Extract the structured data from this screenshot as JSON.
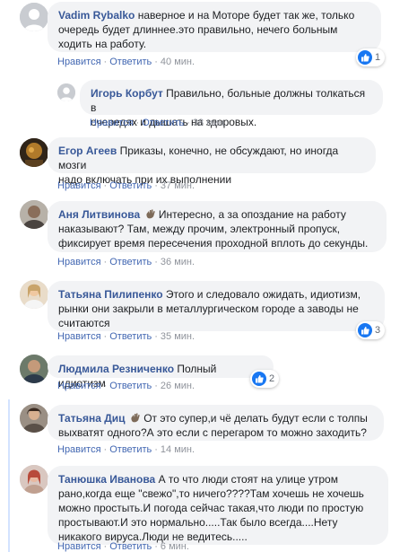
{
  "actions": {
    "like": "Нравится",
    "reply": "Ответить",
    "separator": "·"
  },
  "comments": [
    {
      "author": "Vadim Rybalko",
      "lines": [
        "наверное и на Моторе будет так же, только",
        "очередь будет длиннее.это правильно, нечего больным",
        "ходить на работу."
      ],
      "time": "40 мин.",
      "reactions": "1",
      "avatar": "default-silhouette"
    },
    {
      "author": "Игорь Корбут",
      "lines": [
        "Правильно, больные должны толкаться в",
        "очередях и дышать на здоровых."
      ],
      "time": "38 мин.",
      "avatar": "default-silhouette"
    },
    {
      "author": "Егор Агеев",
      "lines": [
        "Приказы, конечно, не обсуждают, но иногда мозги",
        "надо включать при их выполнении"
      ],
      "time": "37 мин.",
      "avatar": "photo"
    },
    {
      "author": "Аня Литвинова",
      "lines": [
        "Интересно, а за опоздание на работу",
        "наказывают? Там, между прочим, электронный пропуск,",
        "фиксирует время пересечения проходной вплоть до секунды."
      ],
      "time": "36 мин.",
      "avatar": "photo"
    },
    {
      "author": "Татьяна Пилипенко",
      "lines": [
        "Этого и следовало ожидать, идиотизм,",
        "рынки они закрыли в металлургическом городе а заводы не",
        "считаются"
      ],
      "time": "35 мин.",
      "reactions": "3",
      "avatar": "photo"
    },
    {
      "author": "Людмила Резниченко",
      "lines": [
        "Полный идиотизм"
      ],
      "time": "26 мин.",
      "reactions": "2",
      "avatar": "photo"
    },
    {
      "author": "Татьяна Диц",
      "lines": [
        "От это супер,и чё делать будут если с толпы",
        "выхватят одного?А это если с перегаром то можно заходить?"
      ],
      "time": "14 мин.",
      "avatar": "photo"
    },
    {
      "author": "Танюшка Иванова",
      "lines": [
        "А то что люди стоят на улице утром",
        "рано,когда еще \"свежо\",то ничего????Там хочешь не хочешь",
        "можно простыть.И погода сейчас такая,что люди по простую",
        "простывают.И это нормально.....Так было всегда....Нету",
        "никакого вируса.Люди не ведитесь....."
      ],
      "time": "6 мин.",
      "avatar": "photo"
    }
  ],
  "colors": {
    "author": "#385898",
    "link": "#4267b2",
    "bubble": "#f2f3f5",
    "like": "#1877f2"
  }
}
